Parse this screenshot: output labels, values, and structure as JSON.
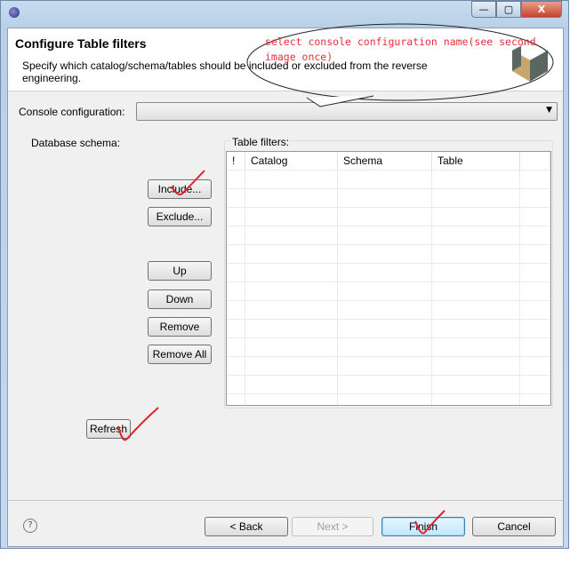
{
  "window": {
    "controls": {
      "minimize": "—",
      "maximize": "▢",
      "close": "X"
    }
  },
  "header": {
    "title": "Configure Table filters",
    "description": "Specify which catalog/schema/tables should be included or excluded from the reverse engineering."
  },
  "console": {
    "label": "Console configuration:",
    "value": ""
  },
  "schema": {
    "label": "Database schema:"
  },
  "buttons": {
    "include": "Include...",
    "exclude": "Exclude...",
    "up": "Up",
    "down": "Down",
    "remove": "Remove",
    "remove_all": "Remove All",
    "refresh": "Refresh"
  },
  "filters": {
    "label": "Table filters:",
    "columns": [
      "!",
      "Catalog",
      "Schema",
      "Table"
    ],
    "rows": []
  },
  "footer": {
    "help": "?",
    "back": "< Back",
    "next": "Next >",
    "finish": "Finish",
    "cancel": "Cancel"
  },
  "annotation": {
    "text": "select console configuration name(see second image once)",
    "color": "#e8303a"
  }
}
